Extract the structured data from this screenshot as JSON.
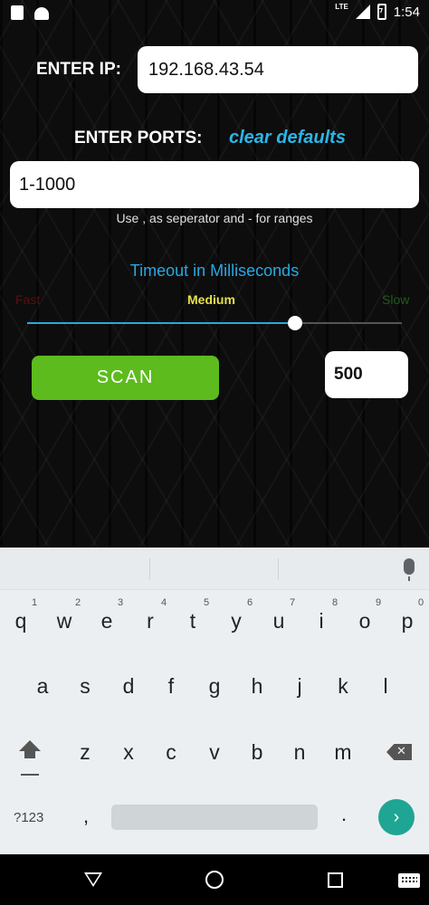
{
  "status_bar": {
    "network": "LTE",
    "time": "1:54"
  },
  "form": {
    "ip_label": "ENTER IP:",
    "ip_value": "192.168.43.54",
    "ports_label": "ENTER PORTS:",
    "clear_defaults": "clear defaults",
    "ports_value": "1-1000",
    "ports_hint": "Use , as seperator and - for ranges"
  },
  "timeout": {
    "title": "Timeout in Milliseconds",
    "speed_fast": "Fast",
    "speed_medium": "Medium",
    "speed_slow": "Slow",
    "slider_fraction": 0.715,
    "value": "500"
  },
  "scan_button": "SCAN",
  "keyboard": {
    "row1": [
      "q",
      "w",
      "e",
      "r",
      "t",
      "y",
      "u",
      "i",
      "o",
      "p"
    ],
    "row1_numbers": [
      "1",
      "2",
      "3",
      "4",
      "5",
      "6",
      "7",
      "8",
      "9",
      "0"
    ],
    "row2": [
      "a",
      "s",
      "d",
      "f",
      "g",
      "h",
      "j",
      "k",
      "l"
    ],
    "row3": [
      "z",
      "x",
      "c",
      "v",
      "b",
      "n",
      "m"
    ],
    "symbols_key": "?123",
    "comma_key": ",",
    "period_key": ".",
    "enter_glyph": "›"
  },
  "colors": {
    "accent_blue": "#29a8e0",
    "scan_green": "#5dbb1e",
    "medium_yellow": "#e8e048",
    "enter_teal": "#1ea594"
  }
}
